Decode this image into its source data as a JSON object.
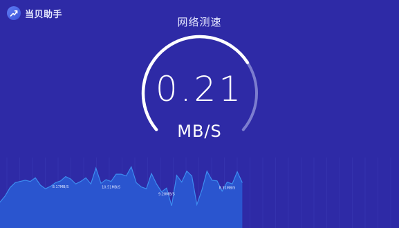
{
  "app": {
    "name": "当贝助手",
    "logo_icon": "trend-arrow-icon"
  },
  "header": {
    "title": "网络测速"
  },
  "gauge": {
    "value": "0.21",
    "unit": "MB/S",
    "progress_fraction": 0.72,
    "track_color": "#7c7dcf",
    "fill_color": "#ffffff"
  },
  "history_graph": {
    "fill_color": "#2a55cf",
    "line_color": "#3d8df0",
    "samples": [
      0.38,
      0.48,
      0.62,
      0.7,
      0.72,
      0.74,
      0.72,
      0.78,
      0.66,
      0.6,
      0.64,
      0.7,
      0.73,
      0.8,
      0.76,
      0.68,
      0.72,
      0.78,
      0.68,
      0.94,
      0.69,
      0.75,
      0.72,
      0.84,
      0.84,
      0.81,
      0.96,
      0.7,
      0.63,
      0.6,
      0.85,
      0.68,
      0.55,
      0.61,
      0.32,
      0.82,
      0.71,
      0.89,
      0.81,
      0.34,
      0.58,
      0.89,
      0.74,
      0.73,
      0.56,
      0.71,
      0.68,
      0.88,
      0.7
    ],
    "annotations": [
      {
        "index": 12,
        "text": "8.17MB/S"
      },
      {
        "index": 22,
        "text": "10.51MB/S"
      },
      {
        "index": 33,
        "text": "9.28MB/S"
      },
      {
        "index": 45,
        "text": "8.31MB/S"
      }
    ]
  }
}
